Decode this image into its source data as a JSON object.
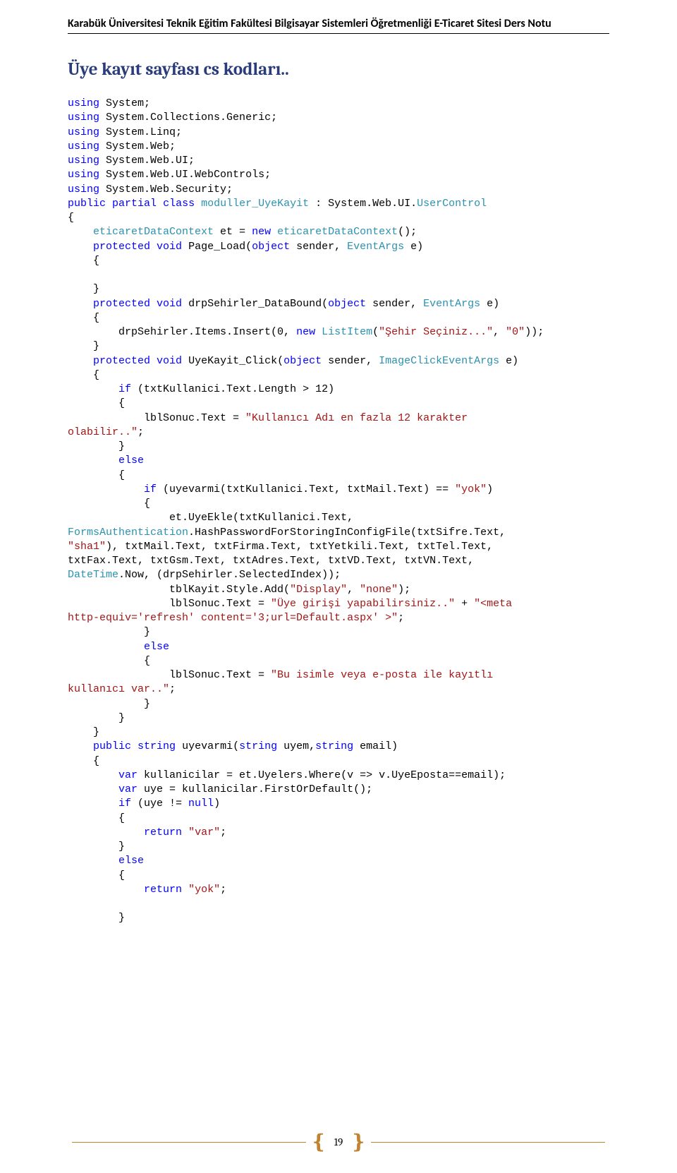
{
  "header": {
    "text": "Karabük Üniversitesi Teknik Eğitim Fakültesi Bilgisayar Sistemleri Öğretmenliği E-Ticaret Sitesi Ders Notu"
  },
  "title": "Üye kayıt sayfası cs kodları..",
  "code": {
    "k_using": "using",
    "ns_system": "System;",
    "ns_collections": "System.Collections.Generic;",
    "ns_linq": "System.Linq;",
    "ns_web": "System.Web;",
    "ns_webui": "System.Web.UI;",
    "ns_webcontrols": "System.Web.UI.WebControls;",
    "ns_security": "System.Web.Security;",
    "k_public": "public",
    "k_partial": "partial",
    "k_class": "class",
    "k_protected": "protected",
    "k_void": "void",
    "k_object": "object",
    "k_new": "new",
    "k_if": "if",
    "k_else": "else",
    "k_return": "return",
    "k_string": "string",
    "k_var": "var",
    "k_null": "null",
    "t_moduller": "moduller_UyeKayit",
    "t_usercontrol": "UserControl",
    "t_eticaret": "eticaretDataContext",
    "t_eventargs": "EventArgs",
    "t_listitem": "ListItem",
    "t_imgclick": "ImageClickEventArgs",
    "t_formsauth": "FormsAuthentication",
    "t_datetime": "DateTime",
    "s_sehir": "\"Şehir Seçiniz...\"",
    "s_zero": "\"0\"",
    "s_kullanici12": "\"Kullanıcı Adı en fazla 12 karakter ",
    "s_olabilir": "olabilir..\"",
    "s_yok": "\"yok\"",
    "s_sha1": "\"sha1\"",
    "s_display": "\"Display\"",
    "s_none": "\"none\"",
    "s_uyegiris": "\"Üye girişi yapabilirsiniz..\"",
    "s_meta": "\"<meta ",
    "s_http_equiv": "http-equiv='refresh' content='3;url=Default.aspx' >\"",
    "s_buisimle": "\"Bu isimle veya e-posta ile kayıtlı ",
    "s_kullanicivar": "kullanıcı var..\"",
    "s_var": "\"var\"",
    "s_yok2": "\"yok\"",
    "txt_et_eq": " et = ",
    "txt_new_eticaret_tail": "();",
    "txt_pageload": " Page_Load(",
    "txt_sender": " sender, ",
    "txt_e_close": " e)",
    "txt_drpbound": " drpSehirler_DataBound(",
    "txt_drp_insert": "        drpSehirler.Items.Insert(0, ",
    "txt_comma_sp": ", ",
    "txt_close_paren_semi": "));",
    "txt_uyekayit": " UyeKayit_Click(",
    "txt_if_len": " (txtKullanici.Text.Length > 12)",
    "txt_lblsonuc": "            lblSonuc.Text = ",
    "txt_semicolon": ";",
    "txt_if_uyevarmi": " (uyevarmi(txtKullanici.Text, txtMail.Text) == ",
    "txt_close_paren": ")",
    "txt_et_uyeekle": "                et.UyeEkle(txtKullanici.Text, ",
    "txt_hash": ".HashPasswordForStoringInConfigFile(txtSifre.Text, ",
    "txt_txtmail_tail": "), txtMail.Text, txtFirma.Text, txtYetkili.Text, txtTel.Text, ",
    "txt_txtfax_line": "txtFax.Text, txtGsm.Text, txtAdres.Text, txtVD.Text, txtVN.Text, ",
    "txt_now_tail": ".Now, (drpSehirler.SelectedIndex));",
    "txt_tblkayit": "                tblKayit.Style.Add(",
    "txt_close_paren_semi2": ");",
    "txt_lblsonuc2": "                lblSonuc.Text = ",
    "txt_plus": " + ",
    "txt_lblsonuc3": "                lblSonuc.Text = ",
    "txt_uyevarmi_sig_a": " uyevarmi(",
    "txt_uyevarmi_sig_b": " uyem,",
    "txt_uyevarmi_sig_c": " email)",
    "txt_kullanicilar": " kullanicilar = et.Uyelers.Where(v => v.UyeEposta==email);",
    "txt_uye": " uye = kullanicilar.FirstOrDefault();",
    "txt_if_uye": " (uye != ",
    "txt_colon_sys": " : System.Web.UI.",
    "brace_open": "{",
    "brace_close": "}",
    "indent4": "    ",
    "indent8": "        ",
    "indent12": "            ",
    "indent16": "                ",
    "space": " "
  },
  "footer": {
    "page_number": "19"
  }
}
